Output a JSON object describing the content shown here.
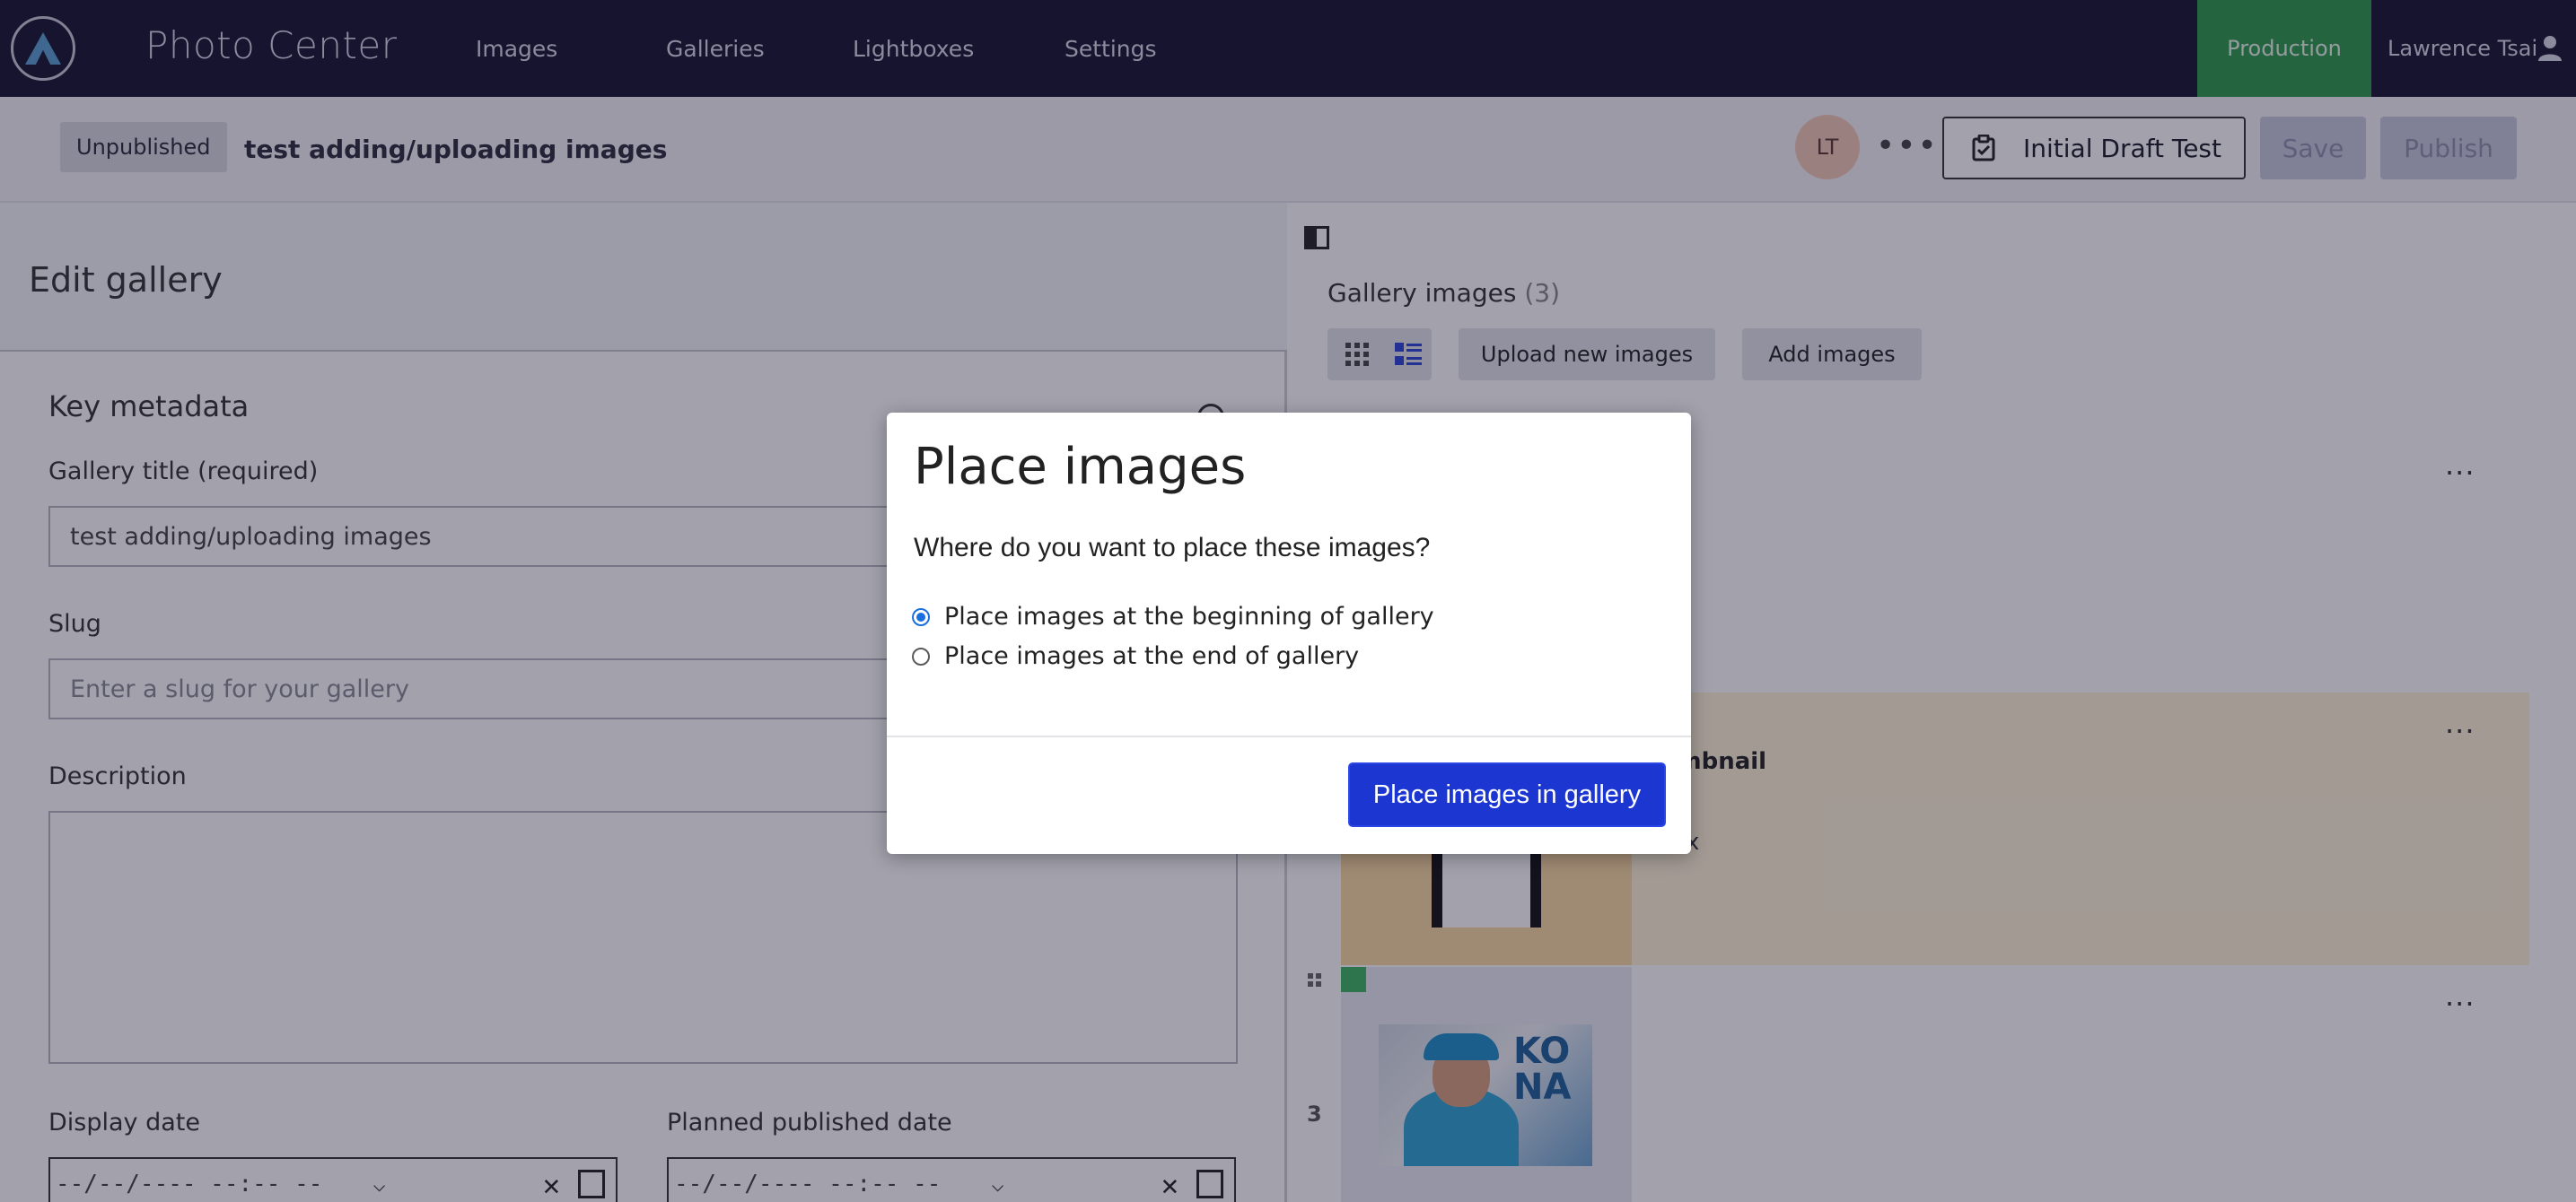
{
  "app": {
    "title": "Photo Center",
    "nav": [
      "Images",
      "Galleries",
      "Lightboxes",
      "Settings"
    ],
    "environment": "Production",
    "user_name": "Lawrence Tsai"
  },
  "subheader": {
    "status": "Unpublished",
    "title": "test adding/uploading images",
    "avatar_initials": "LT",
    "more": "•••",
    "draft_label": "Initial Draft Test",
    "save_label": "Save",
    "publish_label": "Publish"
  },
  "left": {
    "heading": "Edit gallery",
    "section": "Key metadata",
    "title_label": "Gallery title (required)",
    "title_value": "test adding/uploading images",
    "slug_label": "Slug",
    "slug_placeholder": "Enter a slug for your gallery",
    "description_label": "Description",
    "display_date_label": "Display date",
    "planned_date_label": "Planned published date",
    "date_placeholder": "--/--/---- --:-- --"
  },
  "right": {
    "gallery_title": "Gallery images",
    "gallery_count": "(3)",
    "upload_label": "Upload new images",
    "add_label": "Add images",
    "row_more": "···",
    "row2_label": "umbnail",
    "row2_extra": "x",
    "row3_number": "3",
    "photo_sign": "KO\nNA"
  },
  "modal": {
    "title": "Place images",
    "question": "Where do you want to place these images?",
    "options": [
      {
        "label": "Place images at the beginning of gallery",
        "checked": true
      },
      {
        "label": "Place images at the end of gallery",
        "checked": false
      }
    ],
    "confirm_label": "Place images in gallery"
  },
  "colors": {
    "nav_bg": "#161430",
    "production": "#2e9c4a",
    "primary": "#1c36d1",
    "highlight_row": "#fff3d6"
  }
}
